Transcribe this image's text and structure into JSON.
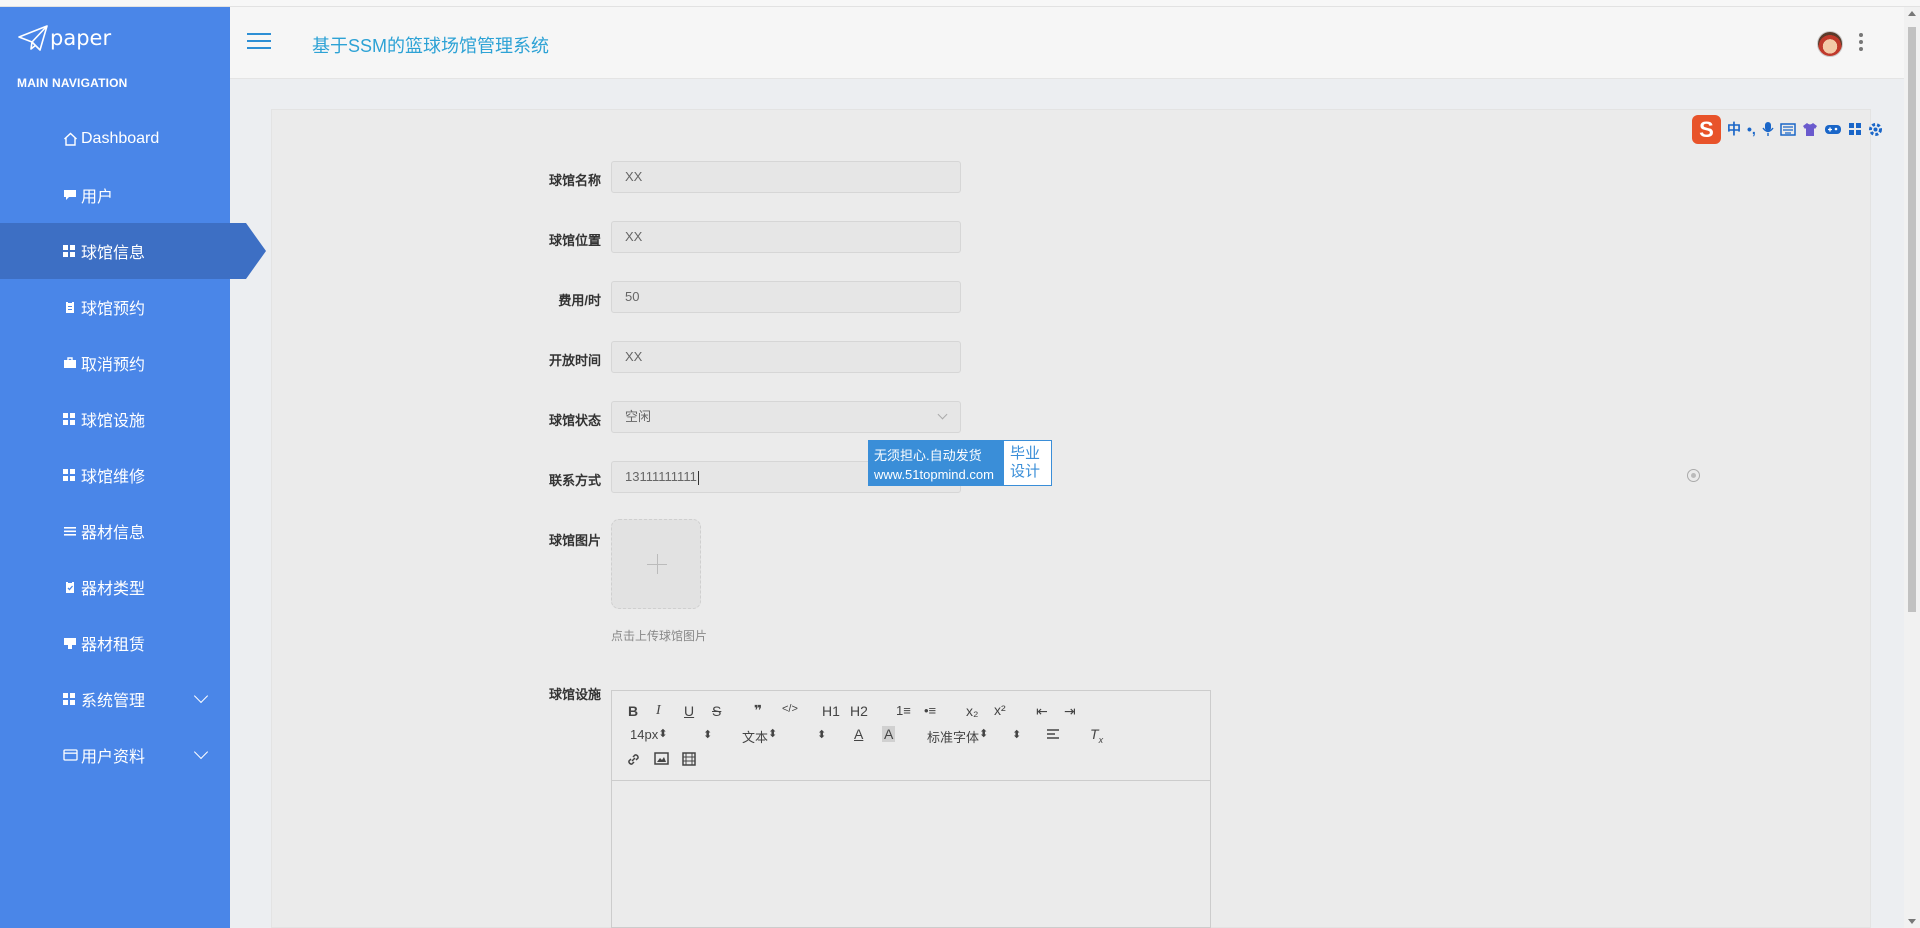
{
  "brand": {
    "logo_text": "paper",
    "accent": "#4a86e8",
    "active_bg": "#3d6fc4"
  },
  "sidebar": {
    "heading": "MAIN NAVIGATION",
    "items": [
      {
        "label": "Dashboard",
        "icon": "home-icon"
      },
      {
        "label": "用户",
        "icon": "comment-icon"
      },
      {
        "label": "球馆信息",
        "icon": "grid-icon",
        "active": true
      },
      {
        "label": "球馆预约",
        "icon": "clipboard-icon"
      },
      {
        "label": "取消预约",
        "icon": "briefcase-icon"
      },
      {
        "label": "球馆设施",
        "icon": "grid-icon"
      },
      {
        "label": "球馆维修",
        "icon": "grid-icon"
      },
      {
        "label": "器材信息",
        "icon": "list-icon"
      },
      {
        "label": "器材类型",
        "icon": "clipboard-check-icon"
      },
      {
        "label": "器材租赁",
        "icon": "card-icon"
      },
      {
        "label": "系统管理",
        "icon": "grid-icon",
        "expandable": true
      },
      {
        "label": "用户资料",
        "icon": "id-card-icon",
        "expandable": true
      }
    ]
  },
  "header": {
    "title": "基于SSM的篮球场馆管理系统"
  },
  "ime_toolbar": {
    "logo": "S",
    "mode": "中",
    "punct": "•,"
  },
  "form": {
    "name": {
      "label": "球馆名称",
      "value": "XX"
    },
    "location": {
      "label": "球馆位置",
      "value": "XX"
    },
    "fee": {
      "label": "费用/时",
      "value": "50"
    },
    "open_time": {
      "label": "开放时间",
      "value": "XX"
    },
    "status": {
      "label": "球馆状态",
      "value": "空闲"
    },
    "contact": {
      "label": "联系方式",
      "value": "13111111111"
    },
    "image": {
      "label": "球馆图片",
      "tip": "点击上传球馆图片"
    },
    "facilities": {
      "label": "球馆设施"
    }
  },
  "ad": {
    "line1": "无须担心.自动发货",
    "line2": "www.51topmind.com",
    "right1": "毕业",
    "right2": "设计"
  },
  "editor": {
    "font_size": "14px",
    "header_select": "文本",
    "font_family": "标准字体",
    "buttons": [
      "B",
      "I",
      "U",
      "S",
      "❞",
      "</>",
      "H1",
      "H2",
      "1≡",
      "•≡",
      "x₂",
      "x²",
      "⇤",
      "⇥"
    ]
  }
}
